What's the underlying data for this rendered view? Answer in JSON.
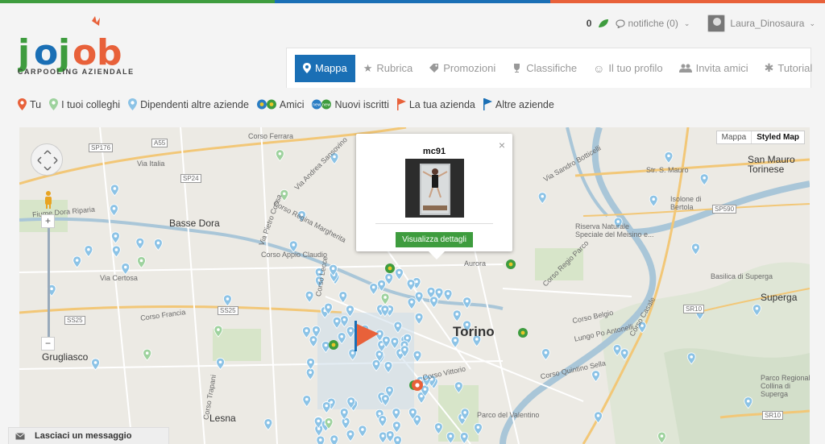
{
  "colors": {
    "bar1": "#3e9c3e",
    "bar2": "#1a6fb5",
    "bar3": "#e8613a",
    "accent": "#1a6fb5",
    "button": "#3e9c3e"
  },
  "logo": {
    "subtitle": "CARPOOLING AZIENDALE"
  },
  "user": {
    "points": "0",
    "notifications_label": "notifiche",
    "notifications_count": "(0)",
    "name": "Laura_Dinosaura"
  },
  "tabs": [
    {
      "label": "Mappa",
      "icon": "map-marker-icon"
    },
    {
      "label": "Rubrica",
      "icon": "star-icon"
    },
    {
      "label": "Promozioni",
      "icon": "tag-icon"
    },
    {
      "label": "Classifiche",
      "icon": "trophy-icon"
    },
    {
      "label": "Il tuo profilo",
      "icon": "smile-icon"
    },
    {
      "label": "Invita amici",
      "icon": "users-icon"
    },
    {
      "label": "Tutorial",
      "icon": "gear-icon"
    }
  ],
  "legend": [
    {
      "label": "Tu"
    },
    {
      "label": "I tuoi colleghi"
    },
    {
      "label": "Dipendenti altre aziende"
    },
    {
      "label": "Amici"
    },
    {
      "label": "Nuovi iscritti"
    },
    {
      "label": "La tua azienda"
    },
    {
      "label": "Altre aziende"
    }
  ],
  "map": {
    "type_options": [
      "Mappa",
      "Styled Map"
    ],
    "selected_type": "Styled Map",
    "labels": [
      "Corso Ferrara",
      "Via Andrea Sansovino",
      "Basse Dora",
      "Corso Regina Margherita",
      "Via Pietro Cossa",
      "Corso Appio Claudio",
      "Via Certosa",
      "Corso Francia",
      "Grugliasco",
      "Lesna",
      "Torino",
      "Corso Vittorio",
      "Parco del Valentino",
      "Riserva Naturale Speciale del Meisino e...",
      "Superga",
      "Basilica di Superga",
      "San Mauro Torinese",
      "Isolone di Bertola",
      "Str. S. Mauro",
      "Corso Belgio",
      "Corso Casale",
      "Lungo Po Antonelli",
      "Parco Regionale Collina di Superga",
      "Corso Quintino Sella",
      "Via Sandro Botticelli",
      "Corso Regio Parco",
      "Aurora",
      "Fiume Dora Riparia",
      "Via Italia",
      "Corso Trapani",
      "Corso Lecce"
    ],
    "road_badges": [
      "SP176",
      "A55",
      "SP24",
      "SS25",
      "SS25",
      "SP590",
      "SR10",
      "SR10"
    ],
    "popup": {
      "name": "mc91",
      "button": "Visualizza dettagli",
      "close": "×"
    }
  },
  "message_bar": {
    "label": "Lasciaci un messaggio"
  }
}
